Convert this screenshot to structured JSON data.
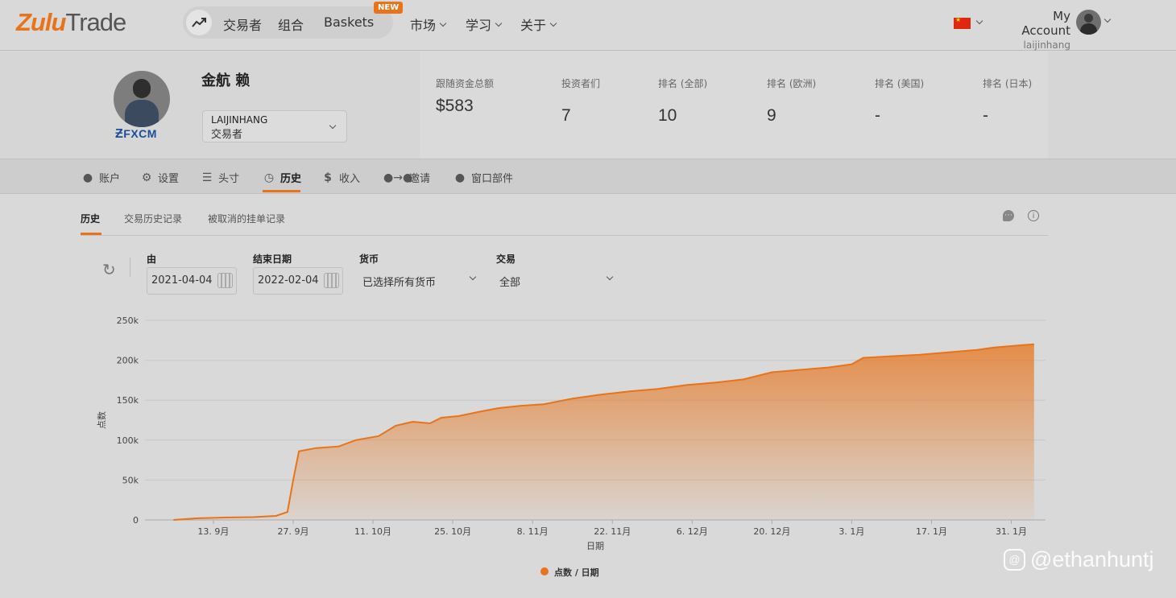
{
  "brand": {
    "zulu": "Zulu",
    "trade": "Trade"
  },
  "nav": {
    "pill_items": [
      "交易者",
      "组合",
      "Baskets"
    ],
    "new_badge": "NEW",
    "menus": [
      "市场",
      "学习",
      "关于"
    ],
    "account_title": "My Account",
    "account_user": "laijinhang"
  },
  "profile": {
    "name": "金航 赖",
    "broker": "FXCM",
    "select_name": "LAIJINHANG",
    "select_role": "交易者",
    "stats": [
      {
        "label": "跟随资金总额",
        "value": "$583"
      },
      {
        "label": "投资者们",
        "value": "7"
      },
      {
        "label": "排名 (全部)",
        "value": "10"
      },
      {
        "label": "排名 (欧洲)",
        "value": "9"
      },
      {
        "label": "排名 (美国)",
        "value": "-"
      },
      {
        "label": "排名 (日本)",
        "value": "-"
      }
    ]
  },
  "tabs": [
    {
      "label": "账户",
      "icon": "user-icon"
    },
    {
      "label": "设置",
      "icon": "gear-icon"
    },
    {
      "label": "头寸",
      "icon": "list-icon"
    },
    {
      "label": "历史",
      "icon": "clock-icon"
    },
    {
      "label": "收入",
      "icon": "dollar-icon"
    },
    {
      "label": "邀请",
      "icon": "invite-icon"
    },
    {
      "label": "窗口部件",
      "icon": "widget-icon"
    }
  ],
  "subtabs": [
    "历史",
    "交易历史记录",
    "被取消的挂单记录"
  ],
  "filters": {
    "from_label": "由",
    "from_value": "2021-04-04",
    "to_label": "结束日期",
    "to_value": "2022-02-04",
    "currency_label": "货币",
    "currency_value": "已选择所有货币",
    "trade_label": "交易",
    "trade_value": "全部"
  },
  "colors": {
    "accent": "#e8731a"
  },
  "watermark": "@ethanhuntj",
  "chart_data": {
    "type": "area",
    "xlabel": "日期",
    "ylabel": "点数",
    "legend": "点数 / 日期",
    "ylim": [
      0,
      250000
    ],
    "yticks": [
      "0",
      "50k",
      "100k",
      "150k",
      "200k",
      "250k"
    ],
    "xticks": [
      "13. 9月",
      "27. 9月",
      "11. 10月",
      "25. 10月",
      "8. 11月",
      "22. 11月",
      "6. 12月",
      "20. 12月",
      "3. 1月",
      "17. 1月",
      "31. 1月"
    ],
    "x": [
      "2021-09-06",
      "2021-09-10",
      "2021-09-15",
      "2021-09-20",
      "2021-09-24",
      "2021-09-26",
      "2021-09-27",
      "2021-09-28",
      "2021-10-01",
      "2021-10-05",
      "2021-10-08",
      "2021-10-12",
      "2021-10-15",
      "2021-10-18",
      "2021-10-21",
      "2021-10-23",
      "2021-10-26",
      "2021-10-30",
      "2021-11-02",
      "2021-11-06",
      "2021-11-10",
      "2021-11-15",
      "2021-11-20",
      "2021-11-25",
      "2021-11-30",
      "2021-12-05",
      "2021-12-10",
      "2021-12-15",
      "2021-12-20",
      "2021-12-25",
      "2021-12-30",
      "2022-01-03",
      "2022-01-05",
      "2022-01-10",
      "2022-01-15",
      "2022-01-20",
      "2022-01-25",
      "2022-01-28",
      "2022-02-02",
      "2022-02-04"
    ],
    "values": [
      0,
      2000,
      3000,
      3500,
      5000,
      10000,
      50000,
      86000,
      90000,
      92000,
      100000,
      105000,
      118000,
      123000,
      121000,
      128000,
      130000,
      136000,
      140000,
      143000,
      145000,
      152000,
      157000,
      161000,
      164000,
      169000,
      172000,
      176000,
      185000,
      188000,
      191000,
      195000,
      203000,
      205000,
      207000,
      210000,
      213000,
      216000,
      219000,
      220000
    ]
  }
}
